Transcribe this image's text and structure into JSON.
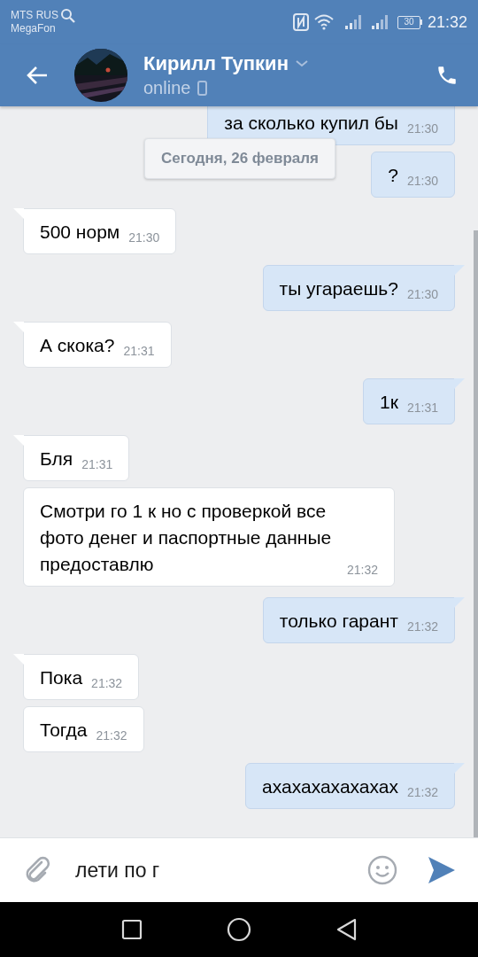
{
  "status_bar": {
    "carriers": [
      "MTS RUS",
      "MegaFon"
    ],
    "battery": "30",
    "time": "21:32"
  },
  "header": {
    "name": "Кирилл Тупкин",
    "status": "online"
  },
  "date_separator": "Сегодня, 26 февраля",
  "messages": [
    {
      "kind": "outgoing",
      "text": "за сколько купил бы",
      "time": "21:30"
    },
    {
      "kind": "outgoing",
      "text": "?",
      "time": "21:30"
    },
    {
      "kind": "incoming",
      "text": "500 норм",
      "time": "21:30"
    },
    {
      "kind": "outgoing",
      "text": "ты угараешь?",
      "time": "21:30"
    },
    {
      "kind": "incoming",
      "text": "А скока?",
      "time": "21:31"
    },
    {
      "kind": "outgoing",
      "text": "1к",
      "time": "21:31"
    },
    {
      "kind": "incoming",
      "text": "Бля",
      "time": "21:31"
    },
    {
      "kind": "incoming",
      "text": "Смотри го 1 к но с проверкой все фото денег и паспортные данные предоставлю",
      "time": "21:32"
    },
    {
      "kind": "outgoing",
      "text": "только гарант",
      "time": "21:32"
    },
    {
      "kind": "incoming",
      "text": "Пока",
      "time": "21:32"
    },
    {
      "kind": "incoming",
      "text": "Тогда",
      "time": "21:32"
    },
    {
      "kind": "outgoing",
      "text": "ахахахахахахах",
      "time": "21:32"
    }
  ],
  "composer": {
    "value": "лети по г"
  }
}
